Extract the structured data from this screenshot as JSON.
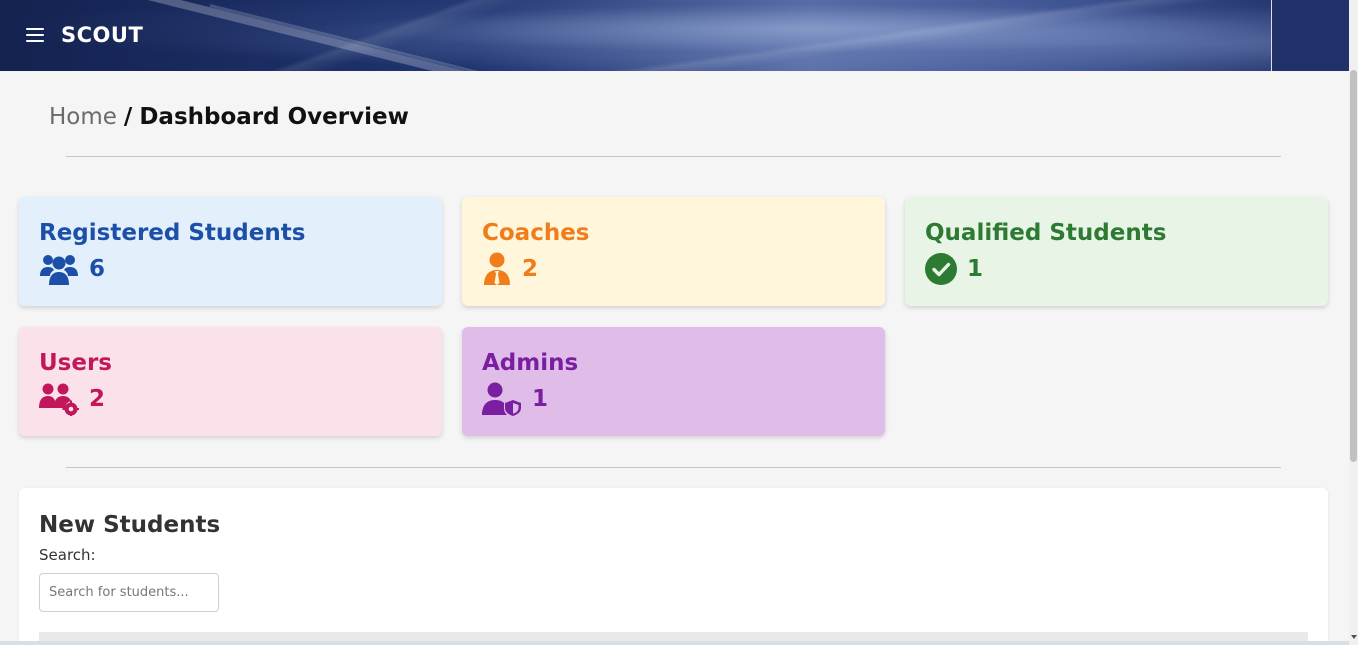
{
  "header": {
    "brand": "SCOUT",
    "menu_icon": "hamburger-menu-icon"
  },
  "breadcrumb": {
    "home": "Home",
    "separator": "/",
    "current": "Dashboard Overview"
  },
  "cards": [
    {
      "title": "Registered Students",
      "count": "6",
      "icon": "users-group-icon",
      "color": "#1b4fa8",
      "background": "#e3f0fc"
    },
    {
      "title": "Coaches",
      "count": "2",
      "icon": "coach-user-tie-icon",
      "color": "#f07d1a",
      "background": "#fff6dc"
    },
    {
      "title": "Qualified Students",
      "count": "1",
      "icon": "check-circle-icon",
      "color": "#2d7a33",
      "background": "#e7f4e6"
    },
    {
      "title": "Users",
      "count": "2",
      "icon": "users-gear-icon",
      "color": "#c2185b",
      "background": "#fbe2ea"
    },
    {
      "title": "Admins",
      "count": "1",
      "icon": "user-shield-icon",
      "color": "#7b1fa2",
      "background": "#e0bde8"
    }
  ],
  "new_students": {
    "title": "New Students",
    "search_label": "Search:",
    "search_placeholder": "Search for students...",
    "search_value": ""
  }
}
